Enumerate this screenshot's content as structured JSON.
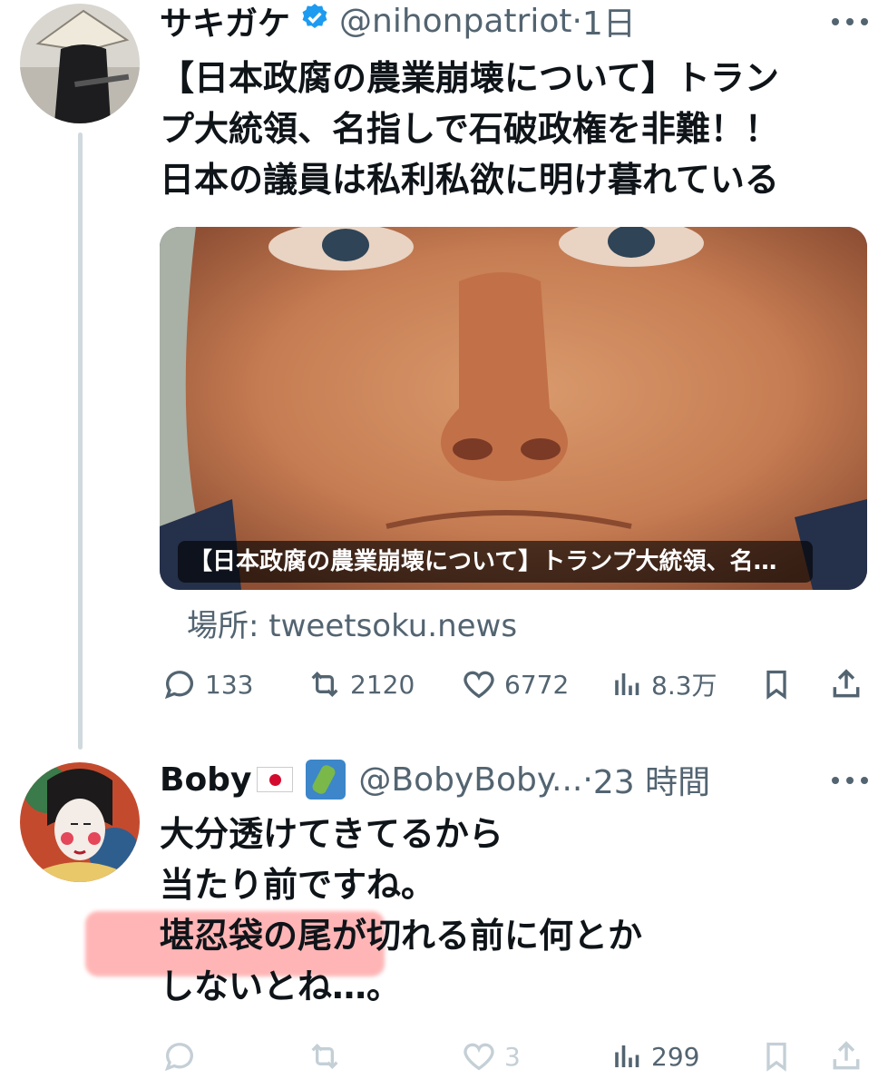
{
  "post1": {
    "display_name": "サキガケ",
    "handle": "@nihonpatriot",
    "separator": "·",
    "time": "1日",
    "text_lines": [
      "【日本政腐の農業崩壊について】トラン",
      "プ大統領、名指しで石破政権を非難！！",
      "日本の議員は私利私欲に明け暮れている"
    ],
    "card_title": "【日本政腐の農業崩壊について】トランプ大統領、名…",
    "source_label": "場所: tweetsoku.news",
    "stats": {
      "replies": "133",
      "reposts": "2120",
      "likes": "6772",
      "views": "8.3万"
    }
  },
  "post2": {
    "display_name": "Boby",
    "handle": "@BobyBoby...",
    "separator": "·",
    "time": "23 時間",
    "text_lines": [
      "大分透けてきてるから",
      "当たり前ですね。",
      "堪忍袋の尾が切れる前に何とか",
      "しないとね…。"
    ],
    "stats": {
      "replies": "",
      "reposts": "",
      "likes": "3",
      "views": "299"
    }
  },
  "colors": {
    "text": "#0f1419",
    "secondary": "#536471",
    "faded": "#c4cfd6",
    "verified": "#1d9bf0",
    "highlight": "#ff7878"
  },
  "icons": [
    "more-icon",
    "verified-badge-icon",
    "reply-icon",
    "repost-icon",
    "like-icon",
    "views-icon",
    "bookmark-icon",
    "share-icon",
    "jp-flag-icon",
    "japan-map-icon"
  ]
}
